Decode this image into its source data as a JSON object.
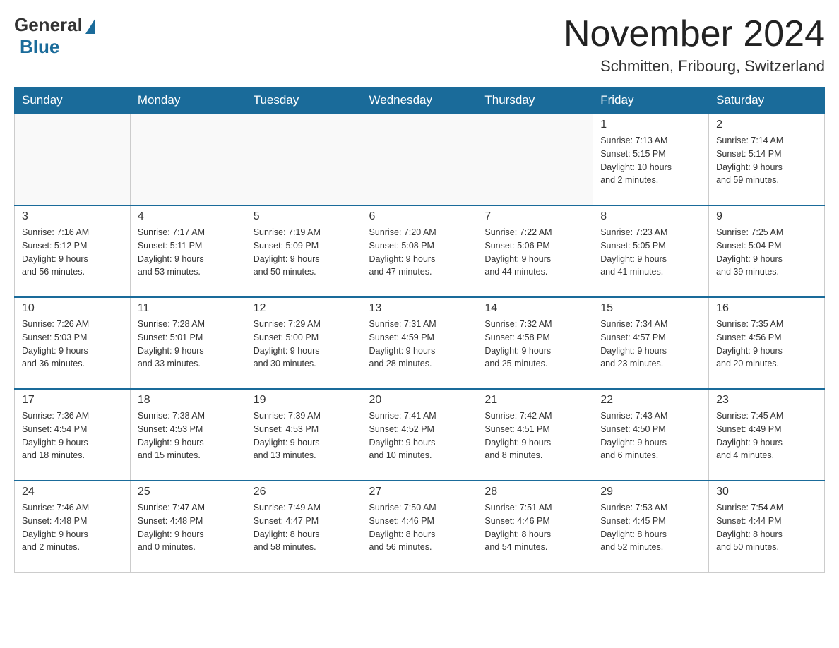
{
  "header": {
    "logo": {
      "general": "General",
      "blue": "Blue"
    },
    "title": "November 2024",
    "location": "Schmitten, Fribourg, Switzerland"
  },
  "weekdays": [
    "Sunday",
    "Monday",
    "Tuesday",
    "Wednesday",
    "Thursday",
    "Friday",
    "Saturday"
  ],
  "weeks": [
    [
      {
        "day": "",
        "info": ""
      },
      {
        "day": "",
        "info": ""
      },
      {
        "day": "",
        "info": ""
      },
      {
        "day": "",
        "info": ""
      },
      {
        "day": "",
        "info": ""
      },
      {
        "day": "1",
        "info": "Sunrise: 7:13 AM\nSunset: 5:15 PM\nDaylight: 10 hours\nand 2 minutes."
      },
      {
        "day": "2",
        "info": "Sunrise: 7:14 AM\nSunset: 5:14 PM\nDaylight: 9 hours\nand 59 minutes."
      }
    ],
    [
      {
        "day": "3",
        "info": "Sunrise: 7:16 AM\nSunset: 5:12 PM\nDaylight: 9 hours\nand 56 minutes."
      },
      {
        "day": "4",
        "info": "Sunrise: 7:17 AM\nSunset: 5:11 PM\nDaylight: 9 hours\nand 53 minutes."
      },
      {
        "day": "5",
        "info": "Sunrise: 7:19 AM\nSunset: 5:09 PM\nDaylight: 9 hours\nand 50 minutes."
      },
      {
        "day": "6",
        "info": "Sunrise: 7:20 AM\nSunset: 5:08 PM\nDaylight: 9 hours\nand 47 minutes."
      },
      {
        "day": "7",
        "info": "Sunrise: 7:22 AM\nSunset: 5:06 PM\nDaylight: 9 hours\nand 44 minutes."
      },
      {
        "day": "8",
        "info": "Sunrise: 7:23 AM\nSunset: 5:05 PM\nDaylight: 9 hours\nand 41 minutes."
      },
      {
        "day": "9",
        "info": "Sunrise: 7:25 AM\nSunset: 5:04 PM\nDaylight: 9 hours\nand 39 minutes."
      }
    ],
    [
      {
        "day": "10",
        "info": "Sunrise: 7:26 AM\nSunset: 5:03 PM\nDaylight: 9 hours\nand 36 minutes."
      },
      {
        "day": "11",
        "info": "Sunrise: 7:28 AM\nSunset: 5:01 PM\nDaylight: 9 hours\nand 33 minutes."
      },
      {
        "day": "12",
        "info": "Sunrise: 7:29 AM\nSunset: 5:00 PM\nDaylight: 9 hours\nand 30 minutes."
      },
      {
        "day": "13",
        "info": "Sunrise: 7:31 AM\nSunset: 4:59 PM\nDaylight: 9 hours\nand 28 minutes."
      },
      {
        "day": "14",
        "info": "Sunrise: 7:32 AM\nSunset: 4:58 PM\nDaylight: 9 hours\nand 25 minutes."
      },
      {
        "day": "15",
        "info": "Sunrise: 7:34 AM\nSunset: 4:57 PM\nDaylight: 9 hours\nand 23 minutes."
      },
      {
        "day": "16",
        "info": "Sunrise: 7:35 AM\nSunset: 4:56 PM\nDaylight: 9 hours\nand 20 minutes."
      }
    ],
    [
      {
        "day": "17",
        "info": "Sunrise: 7:36 AM\nSunset: 4:54 PM\nDaylight: 9 hours\nand 18 minutes."
      },
      {
        "day": "18",
        "info": "Sunrise: 7:38 AM\nSunset: 4:53 PM\nDaylight: 9 hours\nand 15 minutes."
      },
      {
        "day": "19",
        "info": "Sunrise: 7:39 AM\nSunset: 4:53 PM\nDaylight: 9 hours\nand 13 minutes."
      },
      {
        "day": "20",
        "info": "Sunrise: 7:41 AM\nSunset: 4:52 PM\nDaylight: 9 hours\nand 10 minutes."
      },
      {
        "day": "21",
        "info": "Sunrise: 7:42 AM\nSunset: 4:51 PM\nDaylight: 9 hours\nand 8 minutes."
      },
      {
        "day": "22",
        "info": "Sunrise: 7:43 AM\nSunset: 4:50 PM\nDaylight: 9 hours\nand 6 minutes."
      },
      {
        "day": "23",
        "info": "Sunrise: 7:45 AM\nSunset: 4:49 PM\nDaylight: 9 hours\nand 4 minutes."
      }
    ],
    [
      {
        "day": "24",
        "info": "Sunrise: 7:46 AM\nSunset: 4:48 PM\nDaylight: 9 hours\nand 2 minutes."
      },
      {
        "day": "25",
        "info": "Sunrise: 7:47 AM\nSunset: 4:48 PM\nDaylight: 9 hours\nand 0 minutes."
      },
      {
        "day": "26",
        "info": "Sunrise: 7:49 AM\nSunset: 4:47 PM\nDaylight: 8 hours\nand 58 minutes."
      },
      {
        "day": "27",
        "info": "Sunrise: 7:50 AM\nSunset: 4:46 PM\nDaylight: 8 hours\nand 56 minutes."
      },
      {
        "day": "28",
        "info": "Sunrise: 7:51 AM\nSunset: 4:46 PM\nDaylight: 8 hours\nand 54 minutes."
      },
      {
        "day": "29",
        "info": "Sunrise: 7:53 AM\nSunset: 4:45 PM\nDaylight: 8 hours\nand 52 minutes."
      },
      {
        "day": "30",
        "info": "Sunrise: 7:54 AM\nSunset: 4:44 PM\nDaylight: 8 hours\nand 50 minutes."
      }
    ]
  ]
}
